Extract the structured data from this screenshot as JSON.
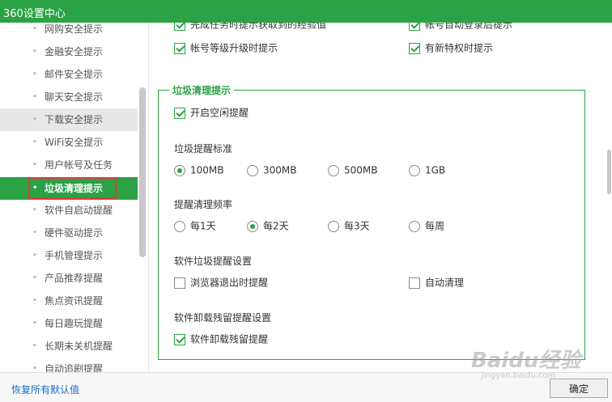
{
  "window": {
    "title": "360设置中心"
  },
  "sidebar": {
    "items": [
      {
        "label": "网购安全提示"
      },
      {
        "label": "金融安全提示"
      },
      {
        "label": "邮件安全提示"
      },
      {
        "label": "聊天安全提示"
      },
      {
        "label": "下载安全提示"
      },
      {
        "label": "WiFi安全提示"
      },
      {
        "label": "用户帐号及任务"
      },
      {
        "label": "垃圾清理提示"
      },
      {
        "label": "软件自启动提醒"
      },
      {
        "label": "硬件驱动提示"
      },
      {
        "label": "手机管理提示"
      },
      {
        "label": "产品推荐提醒"
      },
      {
        "label": "焦点资讯提醒"
      },
      {
        "label": "每日趣玩提醒"
      },
      {
        "label": "长期未关机提醒"
      },
      {
        "label": "自动追剧提醒"
      }
    ],
    "active_index": 7
  },
  "upper_options": {
    "task_exp": {
      "label": "完成任务时提示获取到的经验值",
      "checked": true
    },
    "auto_login": {
      "label": "帐号自动登录后提示",
      "checked": true
    },
    "level_up": {
      "label": "帐号等级升级时提示",
      "checked": true
    },
    "privilege": {
      "label": "有新特权时提示",
      "checked": true
    }
  },
  "junk_section": {
    "title": "垃圾清理提示",
    "idle_reminder": {
      "label": "开启空闲提醒",
      "checked": true
    },
    "standard": {
      "label": "垃圾提醒标准",
      "options": [
        "100MB",
        "300MB",
        "500MB",
        "1GB"
      ],
      "selected": "100MB"
    },
    "frequency": {
      "label": "提醒清理频率",
      "options": [
        "每1天",
        "每2天",
        "每3天",
        "每周"
      ],
      "selected": "每2天"
    },
    "software_junk": {
      "label": "软件垃圾提醒设置",
      "browser_exit": {
        "label": "浏览器退出时提醒",
        "checked": false
      },
      "auto_clean": {
        "label": "自动清理",
        "checked": false
      }
    },
    "uninstall": {
      "label": "软件卸载残留提醒设置",
      "residue": {
        "label": "软件卸载残留提醒",
        "checked": true
      }
    }
  },
  "footer": {
    "reset_label": "恢复所有默认值",
    "ok_label": "确定"
  },
  "watermark": {
    "main": "Baidu经验",
    "sub": "jingyan.baidu.com"
  },
  "colors": {
    "accent": "#2ba245",
    "highlight": "#e23a3a",
    "link": "#1a6ec8"
  }
}
